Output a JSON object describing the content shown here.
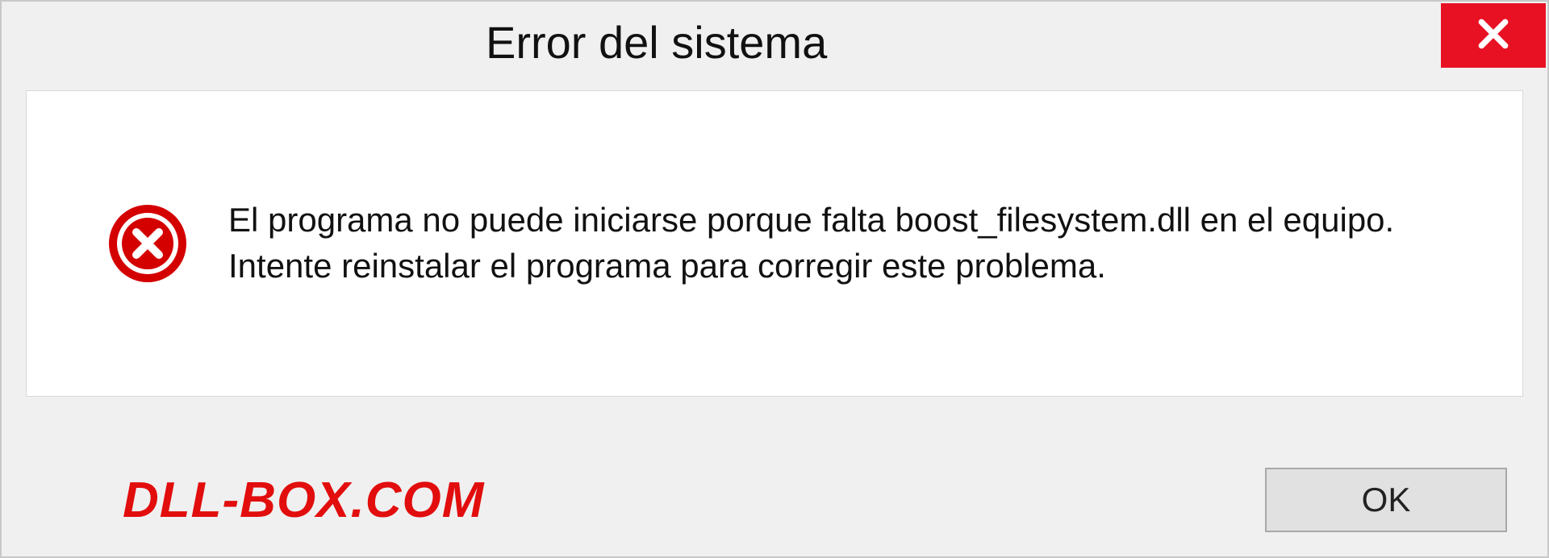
{
  "dialog": {
    "title": "Error del sistema",
    "message": "El programa no puede iniciarse porque falta boost_filesystem.dll en el equipo. Intente reinstalar el programa para corregir este problema.",
    "ok_label": "OK"
  },
  "watermark": "DLL-BOX.COM",
  "colors": {
    "close_bg": "#e81123",
    "error_icon": "#d40000",
    "watermark": "#e20d0d"
  }
}
